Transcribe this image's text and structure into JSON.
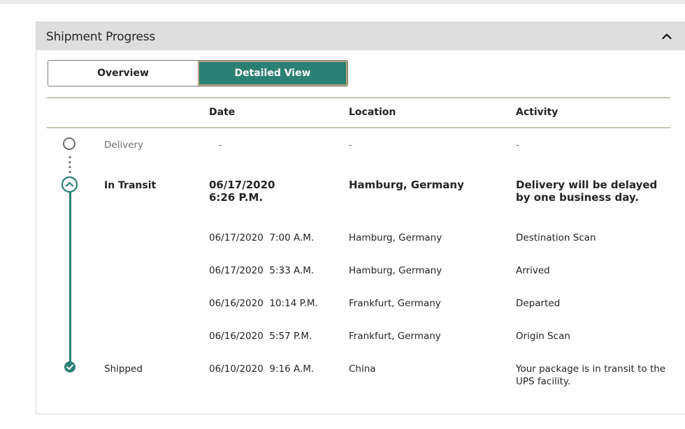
{
  "panel": {
    "title": "Shipment Progress",
    "collapse_icon": "chevron-up-icon"
  },
  "toggle": {
    "overview_label": "Overview",
    "detailed_label": "Detailed View",
    "active": "Detailed View"
  },
  "table": {
    "headers": {
      "date": "Date",
      "location": "Location",
      "activity": "Activity"
    },
    "rows": [
      {
        "status": "Delivery",
        "date": "-",
        "location": "-",
        "activity": "-",
        "icon": "empty-circle-icon"
      },
      {
        "status": "In Transit",
        "date_line1": "06/17/2020",
        "date_line2": "6:26 P.M.",
        "location": "Hamburg, Germany",
        "activity_line1": "Delivery will be delayed",
        "activity_line2": "by one business day.",
        "icon": "chevron-up-circle-icon"
      },
      {
        "date": "06/17/2020  7:00 A.M.",
        "location": "Hamburg, Germany",
        "activity": "Destination Scan"
      },
      {
        "date": "06/17/2020  5:33 A.M.",
        "location": "Hamburg, Germany",
        "activity": "Arrived"
      },
      {
        "date": "06/16/2020  10:14 P.M.",
        "location": "Frankfurt, Germany",
        "activity": "Departed"
      },
      {
        "date": "06/16/2020  5:57 P.M.",
        "location": "Frankfurt, Germany",
        "activity": "Origin Scan"
      },
      {
        "status": "Shipped",
        "date": "06/10/2020  9:16 A.M.",
        "location": "China",
        "activity_line1": "Your package is in transit to the",
        "activity_line2": "UPS facility.",
        "icon": "check-circle-icon"
      }
    ]
  },
  "colors": {
    "accent": "#2b8075",
    "header_bg": "#dedede",
    "rule": "#c8c1b4",
    "muted_text": "#707070"
  }
}
